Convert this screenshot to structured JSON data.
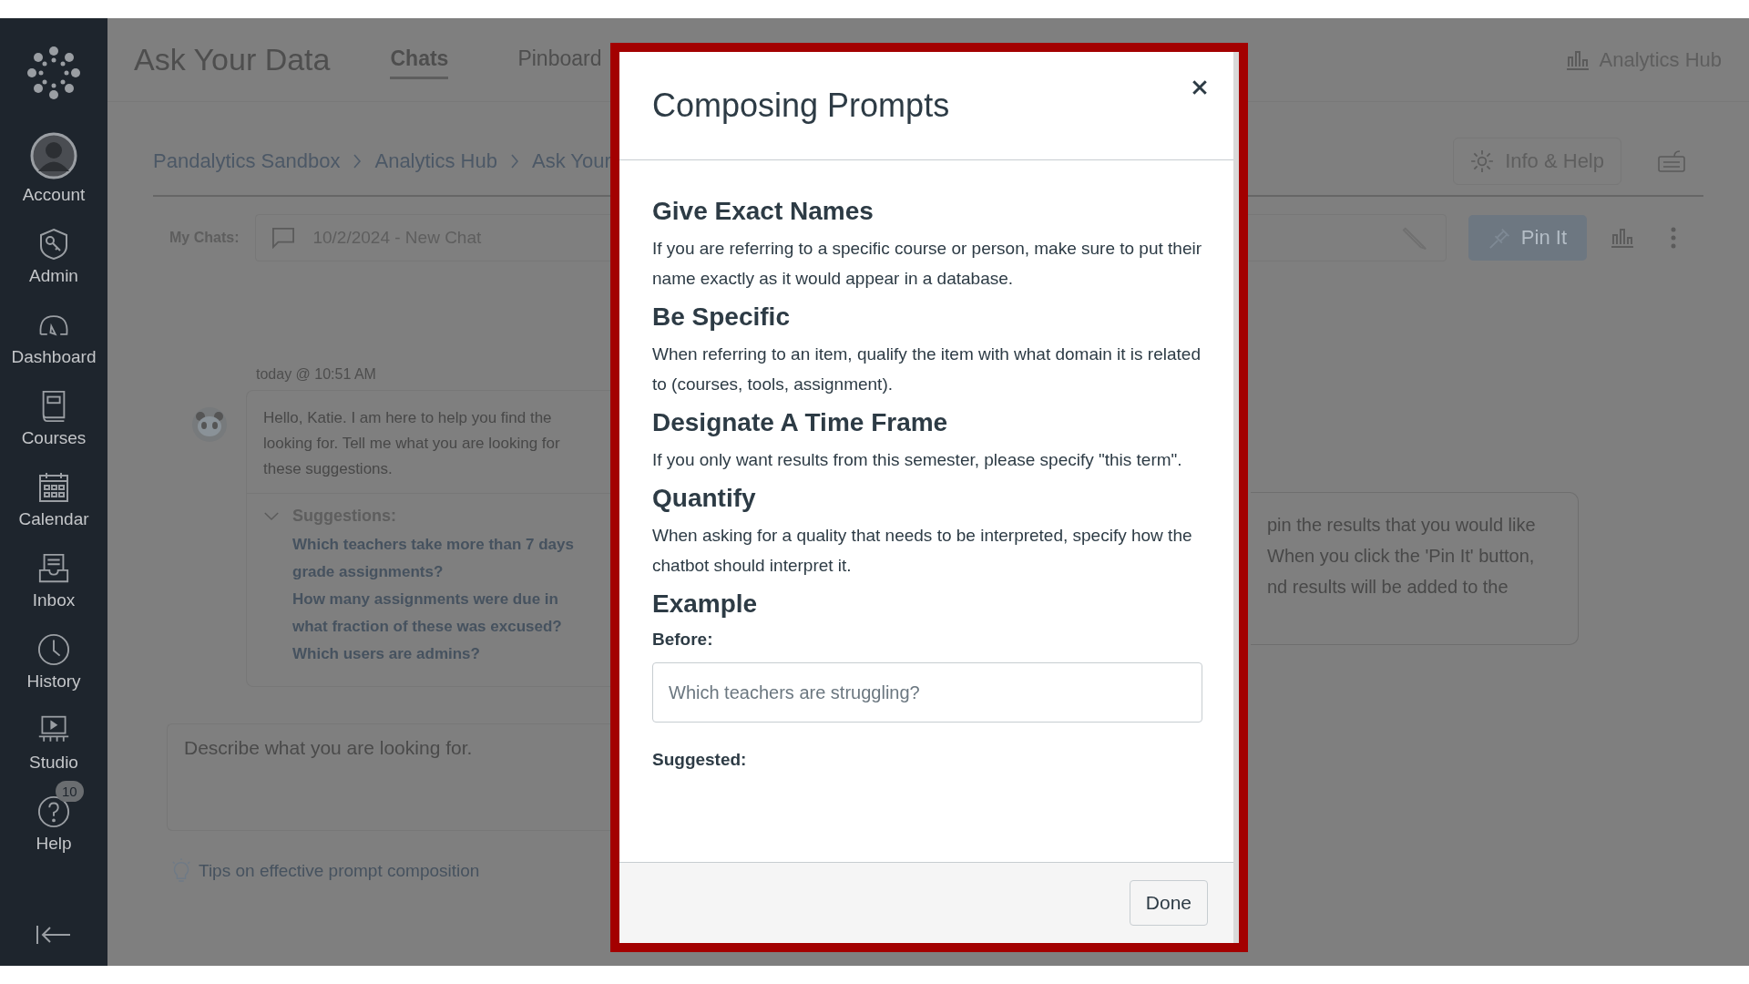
{
  "sidebar": {
    "items": [
      {
        "kind": "account",
        "label": "Account"
      },
      {
        "kind": "admin",
        "label": "Admin"
      },
      {
        "kind": "dashboard",
        "label": "Dashboard"
      },
      {
        "kind": "courses",
        "label": "Courses"
      },
      {
        "kind": "calendar",
        "label": "Calendar"
      },
      {
        "kind": "inbox",
        "label": "Inbox"
      },
      {
        "kind": "history",
        "label": "History"
      },
      {
        "kind": "studio",
        "label": "Studio"
      },
      {
        "kind": "help",
        "label": "Help",
        "badge": "10"
      }
    ]
  },
  "header": {
    "title": "Ask Your Data",
    "tabs": [
      {
        "label": "Chats",
        "selected": true
      },
      {
        "label": "Pinboard",
        "selected": false
      }
    ],
    "link": "Analytics Hub"
  },
  "breadcrumbs": [
    "Pandalytics Sandbox",
    "Analytics Hub",
    "Ask Your"
  ],
  "info_button": "Info & Help",
  "chat_bar": {
    "label": "My Chats:",
    "value": "10/2/2024 - New Chat",
    "pin_button": "Pin It"
  },
  "message": {
    "time": "today @ 10:51 AM",
    "lines": [
      "Hello, Katie. I am here to help you find the",
      "looking for. Tell me what you are looking for",
      "these suggestions."
    ],
    "suggestions_label": "Suggestions:",
    "suggestions": [
      "Which teachers take more than 7 days",
      "grade assignments?",
      "How many assignments were due in",
      "what fraction of these was excused?",
      "Which users are admins?"
    ]
  },
  "prompt_input": {
    "placeholder": "Describe what you are looking for."
  },
  "tips_link": "Tips on effective prompt composition",
  "pin_info": {
    "lines": [
      "pin the results that you would like",
      "When you click the 'Pin It' button,",
      "nd results will be added to the"
    ]
  },
  "dialog": {
    "title": "Composing Prompts",
    "sections": [
      {
        "heading": "Give Exact Names",
        "text": "If you are referring to a specific course or person, make sure to put their name exactly as it would appear in a database."
      },
      {
        "heading": "Be Specific",
        "text": "When referring to an item, qualify the item with what domain it is related to (courses, tools, assignment)."
      },
      {
        "heading": "Designate A Time Frame",
        "text": "If you only want results from this semester, please specify \"this term\"."
      },
      {
        "heading": "Quantify",
        "text": "When asking for a quality that needs to be interpreted, specify how the chatbot should interpret it."
      }
    ],
    "example_heading": "Example",
    "before_label": "Before:",
    "before_value": "Which teachers are struggling?",
    "suggested_label": "Suggested:",
    "button": "Done"
  }
}
